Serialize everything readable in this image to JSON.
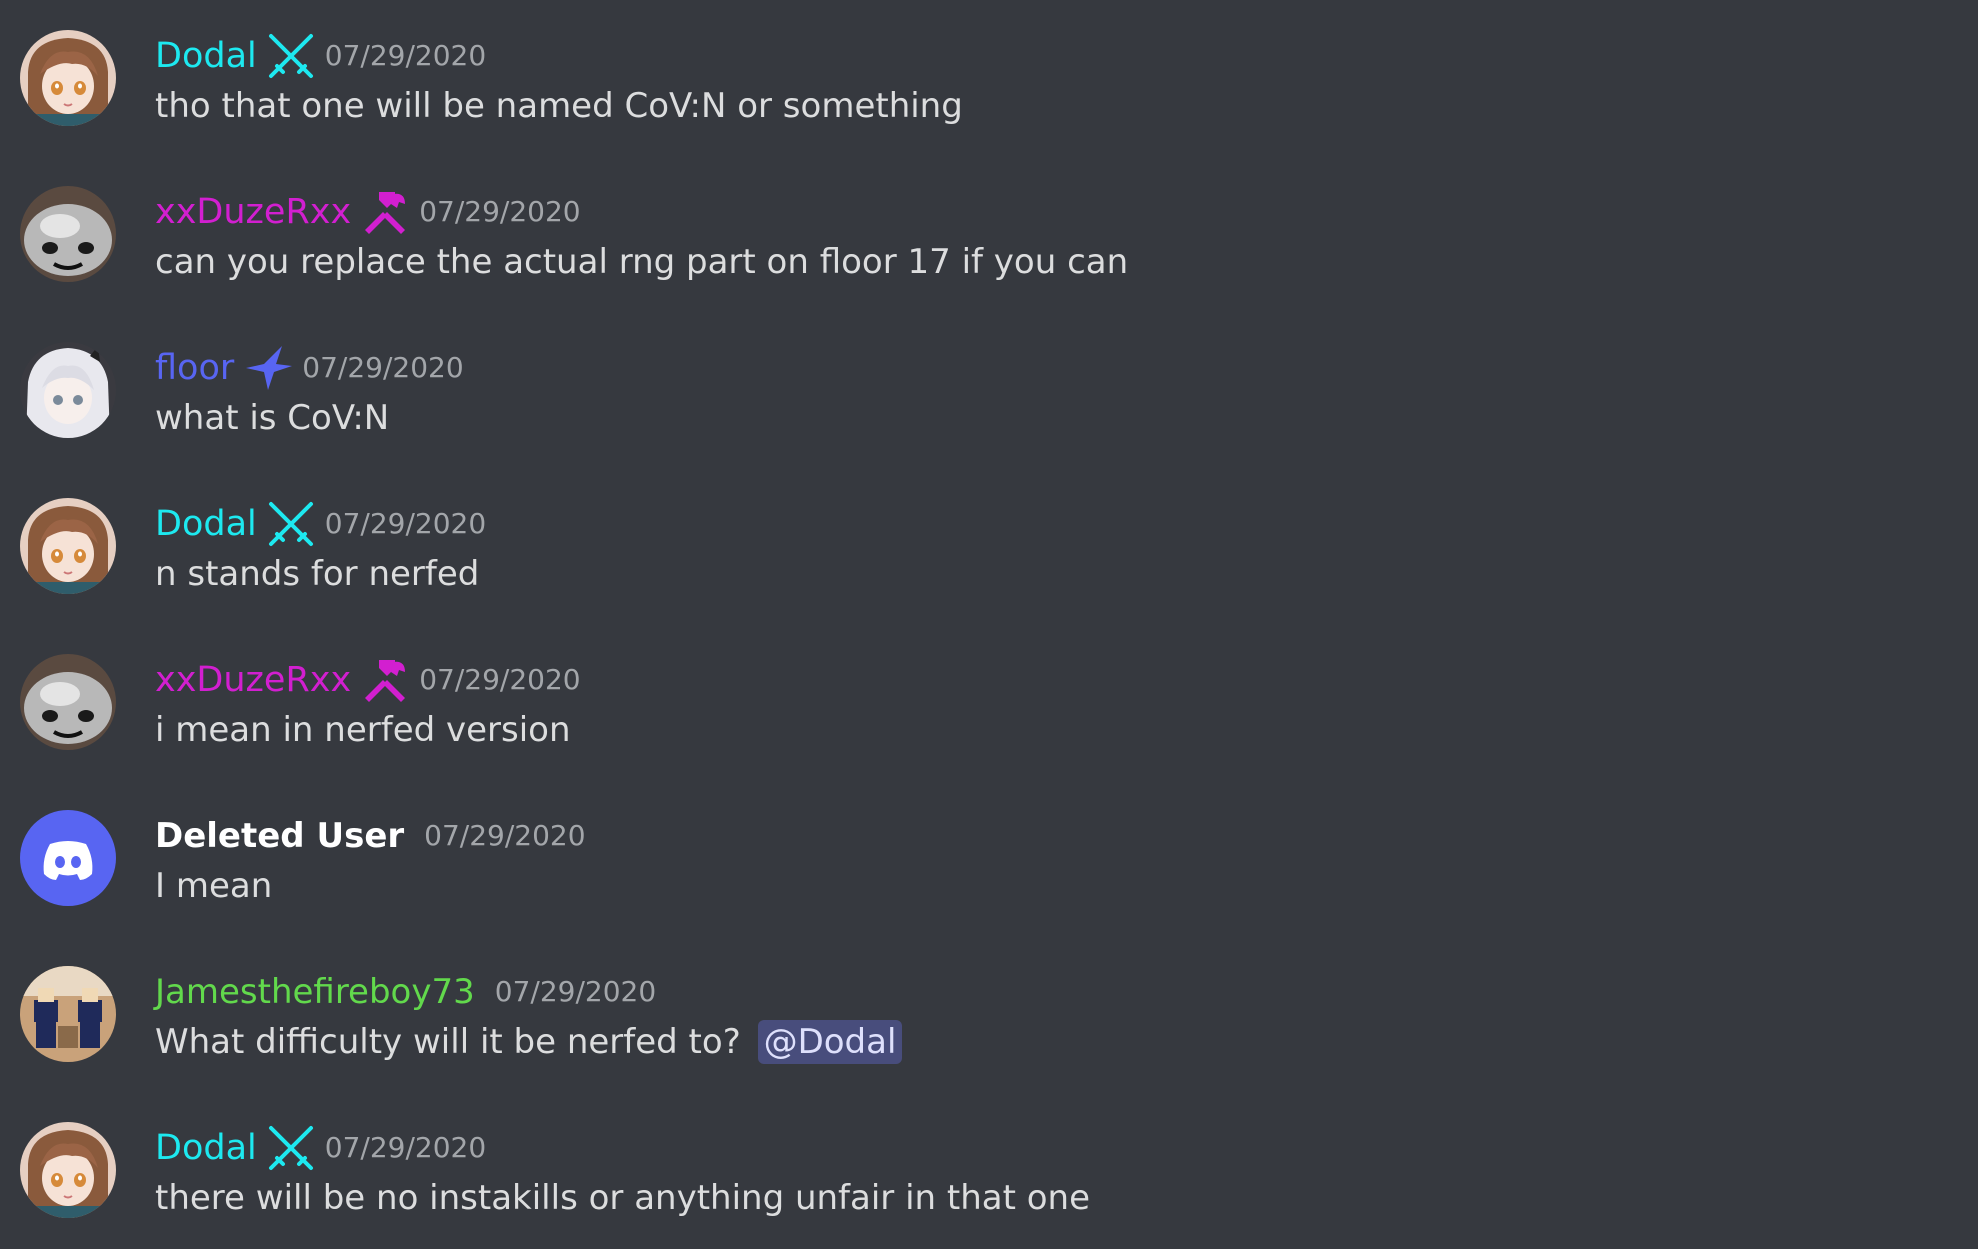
{
  "colors": {
    "background": "#36393f",
    "dodal": "#1de9f0",
    "duze": "#d21fd0",
    "floor": "#5865f2",
    "deleted_user": "#ffffff",
    "james": "#62d94c",
    "timestamp": "#a3a6aa",
    "text": "#dcddde",
    "mention_bg": "#484d7c",
    "mention_text": "#dee0fc",
    "discord_blurple": "#5865f2"
  },
  "messages": [
    {
      "author": "Dodal",
      "role_icon": "crossed-swords-icon",
      "timestamp": "07/29/2020",
      "text": "tho that one will be named CoV:N or something"
    },
    {
      "author": "xxDuzeRxx",
      "role_icon": "hammer-wrench-icon",
      "timestamp": "07/29/2020",
      "text": "can you replace the actual rng part on floor 17 if you can"
    },
    {
      "author": "floor",
      "role_icon": "sparkle-star-icon",
      "timestamp": "07/29/2020",
      "text": "what is CoV:N"
    },
    {
      "author": "Dodal",
      "role_icon": "crossed-swords-icon",
      "timestamp": "07/29/2020",
      "text": "n stands for nerfed"
    },
    {
      "author": "xxDuzeRxx",
      "role_icon": "hammer-wrench-icon",
      "timestamp": "07/29/2020",
      "text": "i mean in nerfed version"
    },
    {
      "author": "Deleted User",
      "role_icon": "",
      "timestamp": "07/29/2020",
      "text": "I mean"
    },
    {
      "author": "Jamesthefireboy73",
      "role_icon": "",
      "timestamp": "07/29/2020",
      "text": "What difficulty will it be nerfed to?",
      "mention": "@Dodal"
    },
    {
      "author": "Dodal",
      "role_icon": "crossed-swords-icon",
      "timestamp": "07/29/2020",
      "text": "there will be no instakills or anything unfair in that one"
    }
  ]
}
